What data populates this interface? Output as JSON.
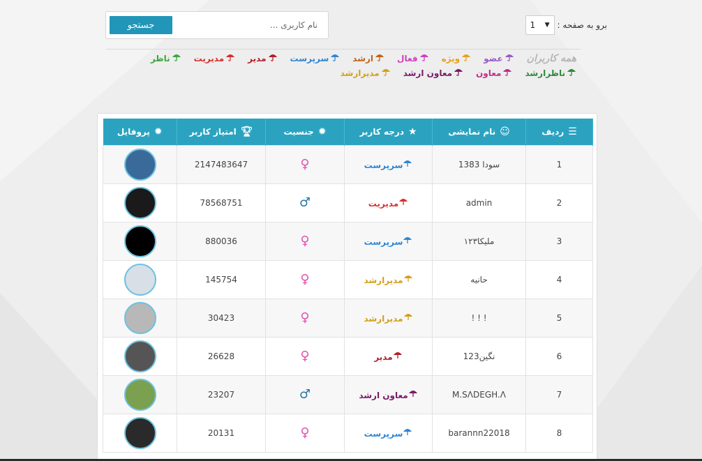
{
  "nav": {
    "page_label": "برو به صفحه :",
    "page_value": "1",
    "dropdown_arrow": "▼"
  },
  "search": {
    "placeholder": "نام کاربری ...",
    "button_label": "جستجو"
  },
  "legend": {
    "all_users": "همه کاربران",
    "ranks": [
      {
        "label": "عضو",
        "color": "#9b5bc4"
      },
      {
        "label": "ویژه",
        "color": "#e6a020"
      },
      {
        "label": "فعال",
        "color": "#d040c0"
      },
      {
        "label": "ارشد",
        "color": "#c0641c"
      },
      {
        "label": "سرپرست",
        "color": "#2e86d4"
      },
      {
        "label": "مدیر",
        "color": "#b2202a"
      },
      {
        "label": "مدیریت",
        "color": "#d63030"
      },
      {
        "label": "ناظر",
        "color": "#3ca63c"
      },
      {
        "label": "ناظرارشد",
        "color": "#2e8a3e"
      },
      {
        "label": "معاون",
        "color": "#c22d8a"
      },
      {
        "label": "معاون ارشد",
        "color": "#7a1a6a"
      },
      {
        "label": "مدیرارشد",
        "color": "#d4a01a"
      }
    ]
  },
  "table": {
    "headers": {
      "row": "ردیف",
      "display_name": "نام نمایشی",
      "rank": "درجه کاربر",
      "gender": "جنسیت",
      "score": "امتیاز کاربر",
      "profile": "پروفایل"
    },
    "header_icons": [
      "list-icon",
      "smiley-icon",
      "star-icon",
      "gear-icon",
      "trophy-icon",
      "gear-icon"
    ],
    "rows": [
      {
        "n": "1",
        "name": "سودا 1383",
        "rank": "سرپرست",
        "rank_color": "#2e86d4",
        "gender": "♀",
        "gender_type": "f",
        "score": "2147483647",
        "avatar_color": "#3a6a9a"
      },
      {
        "n": "2",
        "name": "admin",
        "rank": "مدیریت",
        "rank_color": "#d63030",
        "gender": "♂",
        "gender_type": "m",
        "score": "78568751",
        "avatar_color": "#1a1a1a"
      },
      {
        "n": "3",
        "name": "ملیکا۱۲۳",
        "rank": "سرپرست",
        "rank_color": "#2e86d4",
        "gender": "♀",
        "gender_type": "f",
        "score": "880036",
        "avatar_color": "#000000"
      },
      {
        "n": "4",
        "name": "حانیه",
        "rank": "مدیرارشد",
        "rank_color": "#d4a01a",
        "gender": "♀",
        "gender_type": "f",
        "score": "145754",
        "avatar_color": "#d8dfe6"
      },
      {
        "n": "5",
        "name": "! ! !",
        "rank": "مدیرارشد",
        "rank_color": "#d4a01a",
        "gender": "♀",
        "gender_type": "f",
        "score": "30423",
        "avatar_color": "#b8b8b8"
      },
      {
        "n": "6",
        "name": "نگین123",
        "rank": "مدیر",
        "rank_color": "#b2202a",
        "gender": "♀",
        "gender_type": "f",
        "score": "26628",
        "avatar_color": "#555555"
      },
      {
        "n": "7",
        "name": "M.SΛDEGH.Λ",
        "rank": "معاون ارشد",
        "rank_color": "#7a1a6a",
        "gender": "♂",
        "gender_type": "m",
        "score": "23207",
        "avatar_color": "#7aa050"
      },
      {
        "n": "8",
        "name": "barannn22018",
        "rank": "سرپرست",
        "rank_color": "#2e86d4",
        "gender": "♀",
        "gender_type": "f",
        "score": "20131",
        "avatar_color": "#2a2a2a"
      }
    ]
  }
}
